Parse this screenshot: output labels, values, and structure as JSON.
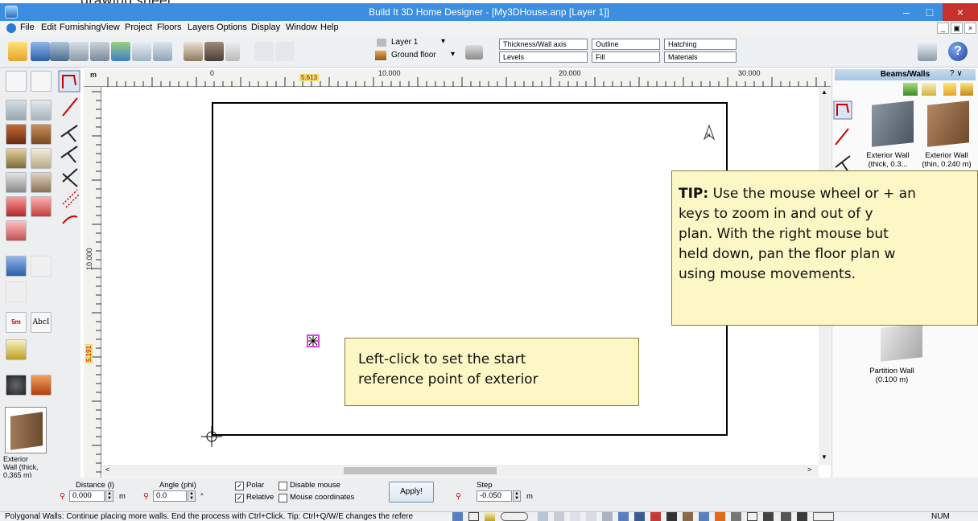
{
  "cutoff_text": "drawing sheet.",
  "window": {
    "title": "Build It 3D Home Designer - [My3DHouse.anp [Layer 1]]",
    "minimize": "–",
    "maximize": "□",
    "close": "×"
  },
  "menu": {
    "items": [
      "File",
      "Edit",
      "Furnishing",
      "View",
      "Project",
      "Floors",
      "Layers",
      "Options",
      "Display",
      "Window",
      "Help"
    ],
    "mdi_minimize": "_",
    "mdi_restore": "▣",
    "mdi_close": "×"
  },
  "toolbar": {
    "layer_label": "Layer 1",
    "floor_label": "Ground floor",
    "dropdowns": [
      "Thickness/Wall axis",
      "Outline",
      "Hatching",
      "Levels",
      "Fill",
      "Materials"
    ]
  },
  "ruler": {
    "unit": "m",
    "h_labels": [
      "0",
      "10.000",
      "20.000",
      "30.000"
    ],
    "h_marker": "5.613",
    "v_labels": [
      "10.000"
    ],
    "v_marker": "5.191"
  },
  "left_panel": {
    "text_tool": "AbcI",
    "dimension_tool": "5m",
    "selected_caption": "Exterior Wall (thick, 0.365 m)"
  },
  "tip": {
    "bold": "TIP:",
    "lines": [
      " Use the mouse wheel or + an",
      "keys to zoom in and out of y",
      "plan.  With the right mouse but",
      "held down, pan the floor plan w",
      "using mouse movements."
    ]
  },
  "callout": {
    "lines": [
      "Left-click to set the start",
      "reference point of exterior"
    ]
  },
  "library": {
    "header": "Beams/Walls",
    "header_controls": "? ∨",
    "items": [
      {
        "label": "Exterior Wall (thick, 0.3..."
      },
      {
        "label": "Exterior Wall (thin, 0.240 m)"
      },
      {
        "label": "Partition Wall (0.100 m)"
      }
    ]
  },
  "inputs": {
    "distance_label": "Distance (l)",
    "distance_value": "0.000",
    "distance_unit": "m",
    "angle_label": "Angle (phi)",
    "angle_value": "0.0",
    "angle_unit": "°",
    "polar_label": "Polar",
    "relative_label": "Relative",
    "disable_mouse_label": "Disable mouse",
    "mouse_coords_label": "Mouse coordinates",
    "polar_checked": true,
    "relative_checked": true,
    "apply_label": "Apply!",
    "step_label": "Step",
    "step_value": "-0.050",
    "step_unit": "m"
  },
  "status": {
    "text": "Polygonal Walls: Continue placing more walls. End the process with Ctrl+Click. Tip: Ctrl+Q/W/E changes the refere",
    "num": "NUM"
  },
  "colors": {
    "titlebar": "#3b8ee0",
    "close": "#c7312b",
    "tip_bg": "#fdf6c5",
    "marker_magenta": "#e040e0"
  }
}
